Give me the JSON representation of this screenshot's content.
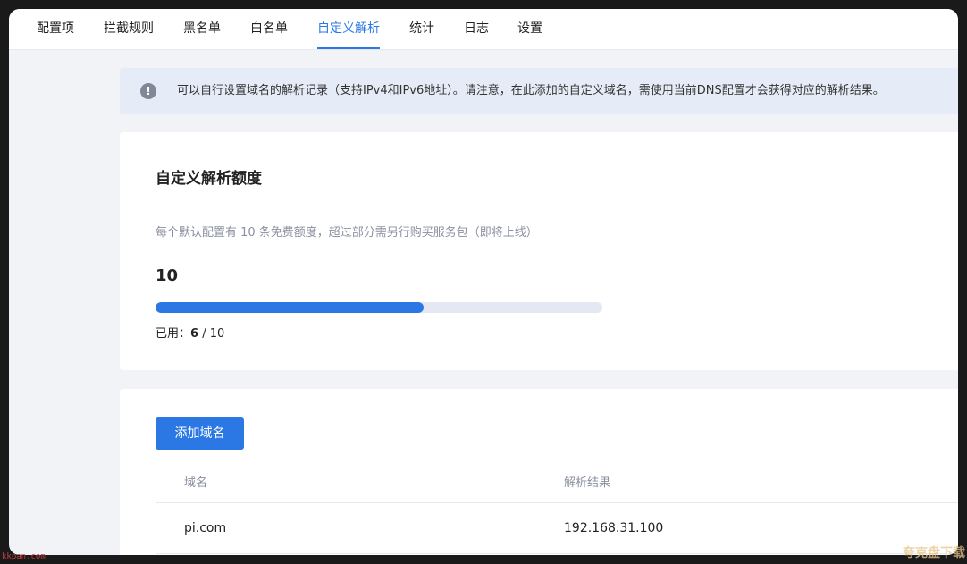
{
  "tabs": [
    {
      "label": "配置项",
      "active": false
    },
    {
      "label": "拦截规则",
      "active": false
    },
    {
      "label": "黑名单",
      "active": false
    },
    {
      "label": "白名单",
      "active": false
    },
    {
      "label": "自定义解析",
      "active": true
    },
    {
      "label": "统计",
      "active": false
    },
    {
      "label": "日志",
      "active": false
    },
    {
      "label": "设置",
      "active": false
    }
  ],
  "notice": {
    "icon": "exclamation-circle-icon",
    "text": "可以自行设置域名的解析记录（支持IPv4和IPv6地址）。请注意，在此添加的自定义域名，需使用当前DNS配置才会获得对应的解析结果。"
  },
  "quota": {
    "title": "自定义解析额度",
    "description": "每个默认配置有 10 条免费额度，超过部分需另行购买服务包（即将上线）",
    "total": "10",
    "used_label": "已用：",
    "used": "6",
    "separator": " / ",
    "limit": "10",
    "progress_fraction": 0.6
  },
  "records": {
    "add_button": "添加域名",
    "columns": [
      "域名",
      "解析结果"
    ],
    "rows": [
      {
        "domain": "pi.com",
        "result": "192.168.31.100"
      }
    ]
  },
  "watermarks": {
    "left": "kkpan.com",
    "right": "夸克盘下载"
  },
  "colors": {
    "accent": "#2b78e4",
    "notice_bg": "#e6ecf7",
    "page_bg": "#f2f3f7"
  }
}
